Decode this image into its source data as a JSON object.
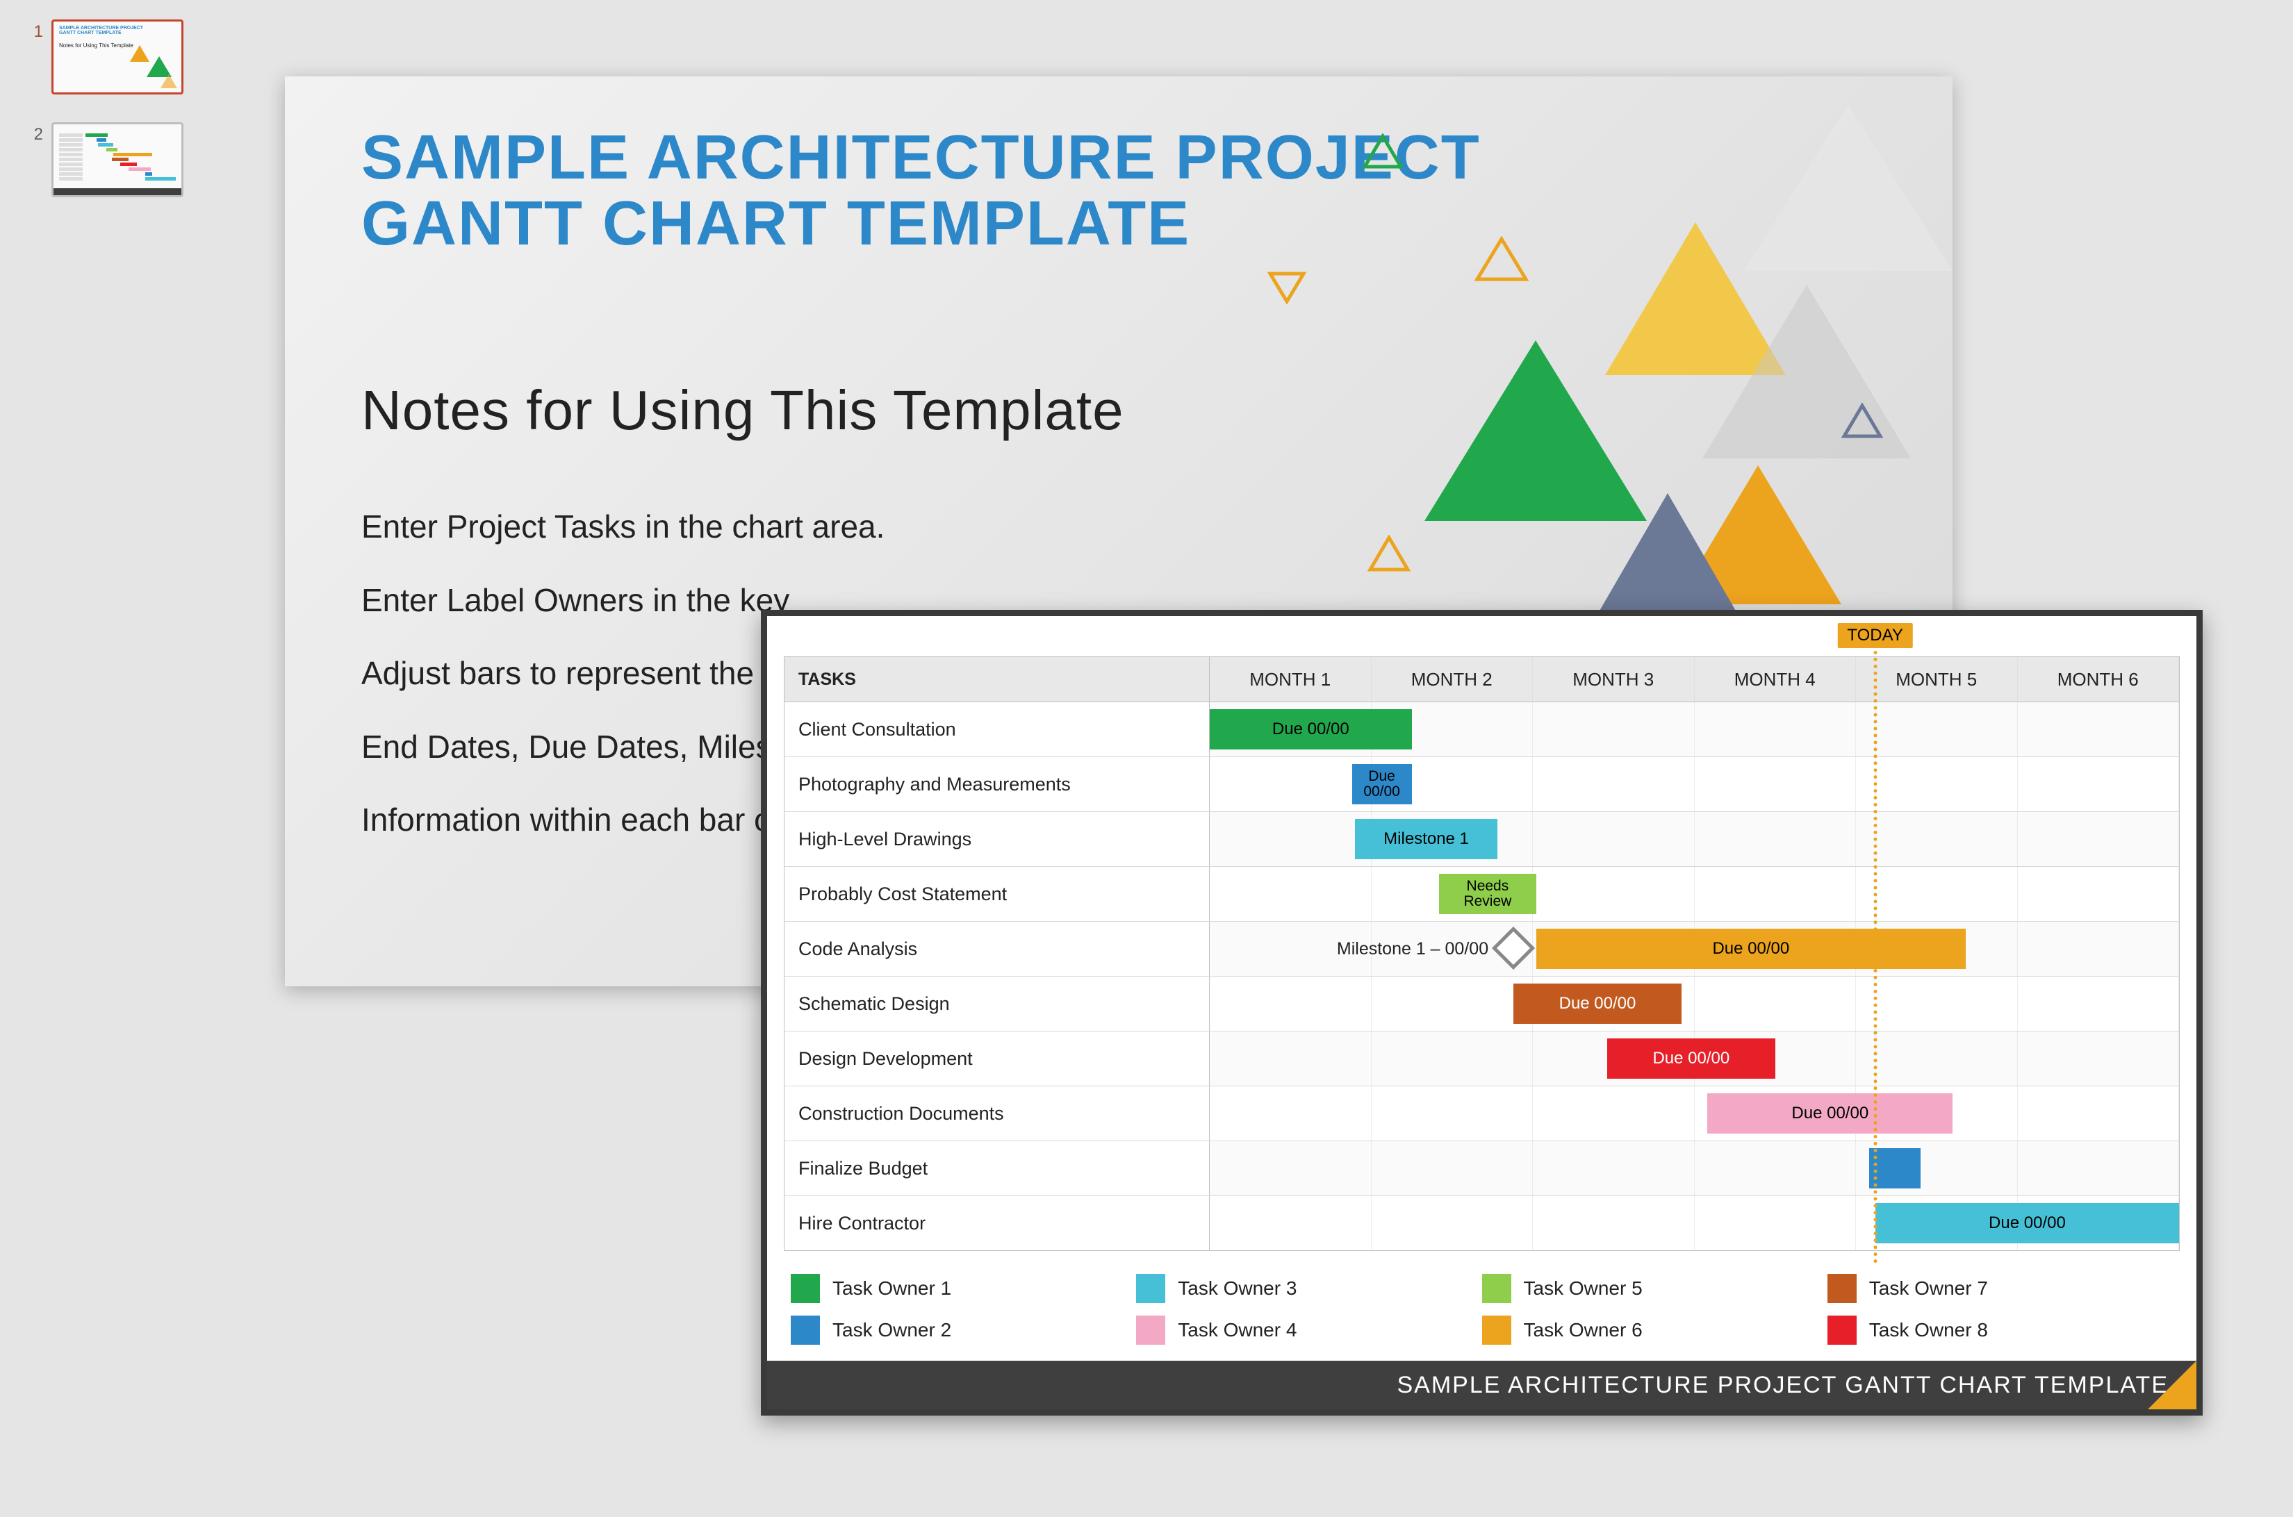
{
  "thumbs": [
    {
      "index": "1",
      "selected": true
    },
    {
      "index": "2",
      "selected": false
    }
  ],
  "slide1": {
    "title_l1": "SAMPLE ARCHITECTURE PROJECT",
    "title_l2": "GANTT CHART TEMPLATE",
    "subtitle": "Notes for Using This Template",
    "body": [
      "Enter Project Tasks in the chart area.",
      "Enter Label Owners in the key",
      "Adjust bars to represent the le",
      "End Dates, Due Dates, Milesto",
      "Information within each bar o"
    ]
  },
  "gantt": {
    "today_label": "TODAY",
    "today_month_frac": 4.08,
    "tasks_header": "TASKS",
    "months": [
      "MONTH 1",
      "MONTH 2",
      "MONTH 3",
      "MONTH 4",
      "MONTH 5",
      "MONTH 6"
    ],
    "footer": "SAMPLE ARCHITECTURE PROJECT GANTT CHART TEMPLATE"
  },
  "chart_data": {
    "type": "gantt",
    "x_categories": [
      "MONTH 1",
      "MONTH 2",
      "MONTH 3",
      "MONTH 4",
      "MONTH 5",
      "MONTH 6"
    ],
    "xlim_months": [
      0,
      6
    ],
    "today_marker_month": 4.08,
    "tasks": [
      {
        "name": "Client Consultation",
        "bar": {
          "start": 0.0,
          "end": 1.25,
          "color": "#21a84d",
          "label": "Due 00/00"
        }
      },
      {
        "name": "Photography and Measurements",
        "bar": {
          "start": 0.88,
          "end": 1.25,
          "color": "#2d88c9",
          "label": "Due 00/00",
          "small": true
        }
      },
      {
        "name": "High-Level Drawings",
        "bar": {
          "start": 0.9,
          "end": 1.78,
          "color": "#45c0d6",
          "label": "Milestone 1"
        }
      },
      {
        "name": "Probably Cost Statement",
        "bar": {
          "start": 1.42,
          "end": 2.02,
          "color": "#8fce4a",
          "label": "Needs Review",
          "small": true
        }
      },
      {
        "name": "Code Analysis",
        "pretext": "Milestone 1 – 00/00",
        "diamond_at": 1.88,
        "bar": {
          "start": 2.02,
          "end": 4.68,
          "color": "#eca31d",
          "label": "Due 00/00"
        }
      },
      {
        "name": "Schematic Design",
        "bar": {
          "start": 1.88,
          "end": 2.92,
          "color": "#c25a1f",
          "label": "Due 00/00",
          "text_color": "#fff"
        }
      },
      {
        "name": "Design Development",
        "bar": {
          "start": 2.46,
          "end": 3.5,
          "color": "#e61f28",
          "label": "Due 00/00",
          "text_color": "#fff"
        }
      },
      {
        "name": "Construction Documents",
        "bar": {
          "start": 3.08,
          "end": 4.6,
          "color": "#f3a9c6",
          "label": "Due 00/00"
        }
      },
      {
        "name": "Finalize Budget",
        "bar": {
          "start": 4.08,
          "end": 4.4,
          "color": "#2d88c9",
          "label": ""
        }
      },
      {
        "name": "Hire Contractor",
        "bar": {
          "start": 4.12,
          "end": 6.0,
          "color": "#45c0d6",
          "label": "Due 00/00"
        }
      }
    ],
    "legend": [
      {
        "label": "Task Owner 1",
        "color": "#21a84d"
      },
      {
        "label": "Task Owner 3",
        "color": "#45c0d6"
      },
      {
        "label": "Task Owner 5",
        "color": "#8fce4a"
      },
      {
        "label": "Task Owner 7",
        "color": "#c25a1f"
      },
      {
        "label": "Task Owner 2",
        "color": "#2d88c9"
      },
      {
        "label": "Task Owner 4",
        "color": "#f3a9c6"
      },
      {
        "label": "Task Owner 6",
        "color": "#eca31d"
      },
      {
        "label": "Task Owner 8",
        "color": "#e61f28"
      }
    ]
  }
}
